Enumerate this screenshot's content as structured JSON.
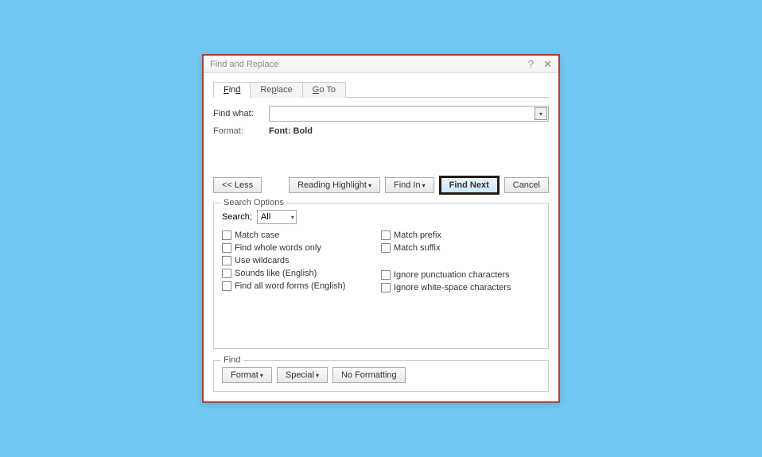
{
  "dialog": {
    "title": "Find and Replace"
  },
  "tabs": {
    "find": "Find",
    "replace": "Replace",
    "goto": "Go To"
  },
  "findRow": {
    "label": "Find what:",
    "value": ""
  },
  "formatRow": {
    "label": "Format:",
    "value": "Font: Bold"
  },
  "buttons": {
    "less": "<< Less",
    "readingHighlight": "Reading Highlight",
    "findIn": "Find In",
    "findNext": "Find Next",
    "cancel": "Cancel"
  },
  "searchOptions": {
    "legend": "Search Options",
    "searchLabel": "Search;",
    "direction": "All",
    "left": {
      "matchCase": "Match case",
      "wholeWords": "Find whole words only",
      "wildcards": "Use wildcards",
      "soundsLike": "Sounds like (English)",
      "wordForms": "Find all word forms (English)"
    },
    "right": {
      "prefix": "Match prefix",
      "suffix": "Match suffix",
      "punct": "Ignore punctuation characters",
      "whitespace": "Ignore white-space characters"
    }
  },
  "findGroup": {
    "legend": "Find",
    "format": "Format",
    "special": "Special",
    "noFormatting": "No Formatting"
  }
}
